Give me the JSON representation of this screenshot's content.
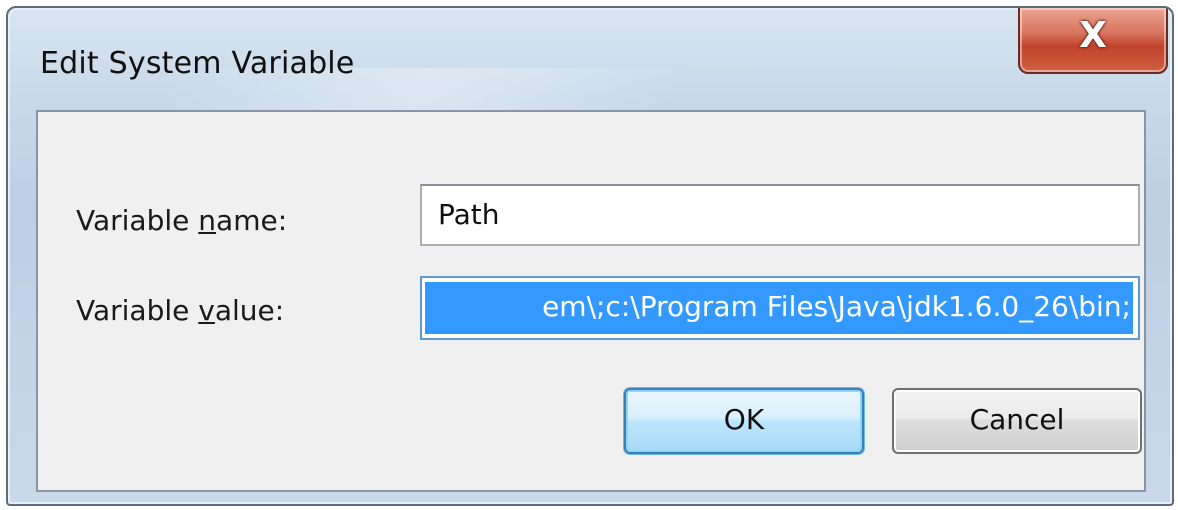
{
  "window": {
    "title": "Edit System Variable",
    "close_glyph": "X"
  },
  "form": {
    "name_label_before": "Variable ",
    "name_label_mnemonic": "n",
    "name_label_after": "ame:",
    "value_label_before": "Variable ",
    "value_label_mnemonic": "v",
    "value_label_after": "alue:",
    "name_value": "Path",
    "value_value": "em\\;c:\\Program Files\\Java\\jdk1.6.0_26\\bin;"
  },
  "buttons": {
    "ok_label": "OK",
    "cancel_label": "Cancel"
  },
  "colors": {
    "selection": "#3399ff",
    "close_button": "#c0432b",
    "default_button_border": "#3c7fb1"
  },
  "icons": {
    "close": "close-icon"
  }
}
